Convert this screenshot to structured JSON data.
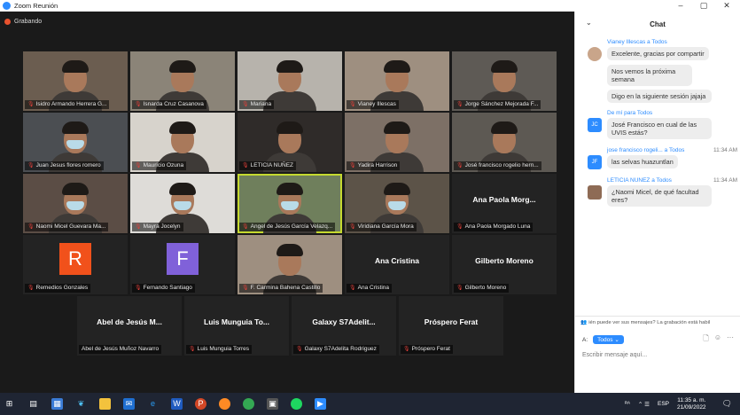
{
  "window": {
    "title": "Zoom Reunión",
    "controls": [
      "–",
      "▢",
      "✕"
    ]
  },
  "recording_label": "Grabando",
  "tiles": [
    {
      "name": "Isidro Armando Herrera G...",
      "kind": "video"
    },
    {
      "name": "Isnarda Cruz Casanova",
      "kind": "video"
    },
    {
      "name": "Mariana",
      "kind": "video"
    },
    {
      "name": "Vianey Illescas",
      "kind": "video"
    },
    {
      "name": "Jorge Sánchez Mejorada F...",
      "kind": "video"
    },
    {
      "name": "Juan Jesus flores romero",
      "kind": "video"
    },
    {
      "name": "Mauricio Ozuna",
      "kind": "video"
    },
    {
      "name": "LETICIA NUÑEZ",
      "kind": "video"
    },
    {
      "name": "Yadira Harrison",
      "kind": "video"
    },
    {
      "name": "José francisco rogelio hern...",
      "kind": "video"
    },
    {
      "name": "Naomi Micel Guevara Ma...",
      "kind": "video"
    },
    {
      "name": "Mayra Jocelyn",
      "kind": "video"
    },
    {
      "name": "Angel de Jesús García Velazq...",
      "kind": "video",
      "active": true
    },
    {
      "name": "Viridiana García Mora",
      "kind": "video"
    },
    {
      "name": "Ana Paola Morgado Luna",
      "kind": "name",
      "display": "Ana Paola Morg..."
    },
    {
      "name": "Remedios Gonzales",
      "kind": "avatar",
      "initial": "R",
      "color": "#f1511b"
    },
    {
      "name": "Fernando Santiago",
      "kind": "avatar",
      "initial": "F",
      "color": "#8061d9"
    },
    {
      "name": "F. Carmina Bahena Castillo",
      "kind": "video"
    },
    {
      "name": "Ana Cristina",
      "kind": "name",
      "display": "Ana Cristina"
    },
    {
      "name": "Gilberto Moreno",
      "kind": "name",
      "display": "Gilberto Moreno"
    },
    {
      "name": "Abel de Jesús Muñoz Navarro",
      "kind": "name",
      "display": "Abel de Jesús M...",
      "unmuted": true
    },
    {
      "name": "Luis Munguia Torres",
      "kind": "name",
      "display": "Luis Munguia To..."
    },
    {
      "name": "Galaxy S7Adelita Rodriguez",
      "kind": "name",
      "display": "Galaxy S7Adelit..."
    },
    {
      "name": "Próspero Ferat",
      "kind": "name",
      "display": "Próspero Ferat"
    }
  ],
  "chat": {
    "title": "Chat",
    "collapse_icon": "chevron-down-icon",
    "messages": [
      {
        "from": "Vianey Illescas a Todos",
        "time": "",
        "bubbles": [
          "Excelente, gracias por compartir",
          "Nos vemos la próxima semana",
          "Digo en la siguiente sesión jajaja"
        ]
      },
      {
        "from": "De mí para Todos",
        "time": "",
        "avatar": "JC",
        "bubbles": [
          "José Francisco en cual de las UVIS estás?"
        ]
      },
      {
        "from": "jose francisco rogeli... a Todos",
        "time": "11:34 AM",
        "avatar": "JF",
        "bubbles": [
          "las selvas huazuntlan"
        ]
      },
      {
        "from": "LETICIA NUÑEZ a Todos",
        "time": "11:34 AM",
        "bubbles": [
          "¿Naomi Micel, de qué facultad eres?"
        ]
      }
    ],
    "notice": "ién puede ver sus mensajes? La grabación está habil",
    "to_label": "A:",
    "to_value": "Todos",
    "input_placeholder": "Escribir mensaje aquí..."
  },
  "taskbar": {
    "apps": [
      "start-icon",
      "task-view-icon",
      "widgets-icon",
      "edge-icon",
      "files-icon",
      "mail-icon",
      "edge-blue-icon",
      "word-icon",
      "powerpoint-icon",
      "firefox-icon",
      "chrome-icon",
      "app-icon",
      "spotify-icon",
      "zoom-icon"
    ],
    "lang": "ESP",
    "time": "11:35 a. m.",
    "date": "21/09/2022"
  }
}
